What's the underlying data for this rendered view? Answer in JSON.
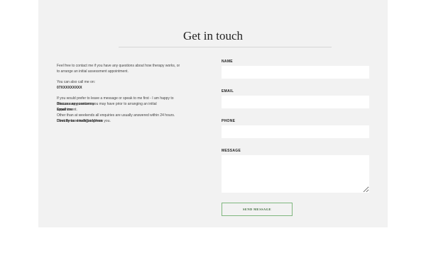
{
  "page": {
    "title": "Get in touch"
  },
  "intro": {
    "p1_line1": "Feel free to contact me if you have any questions about how therapy works, or",
    "p1_line2": "to arrange an initial assessment appointment.",
    "call_text": "You can also call me on:",
    "phone": "07XXXXXXXXX",
    "p3_line1": "If you would prefer to leave a message or speak to me first - I am happy to",
    "p3_line2": "discuss any questions you may have prior to arranging an initial",
    "p3_line2_overlap": "Discuss any concerns",
    "p3_line3": "appointment.",
    "p3_line3_overlap": "Email me",
    "p3_line4": "Other than at weekends all enquiries are usually answered within 24 hours.",
    "p3_line5": "I look forward to hearing from you.",
    "p3_line5_overlap": "Directly to: email@address"
  },
  "form": {
    "name_label": "NAME",
    "email_label": "EMAIL",
    "phone_label": "PHONE",
    "message_label": "MESSAGE",
    "send_label": "SEND MESSAGE"
  }
}
